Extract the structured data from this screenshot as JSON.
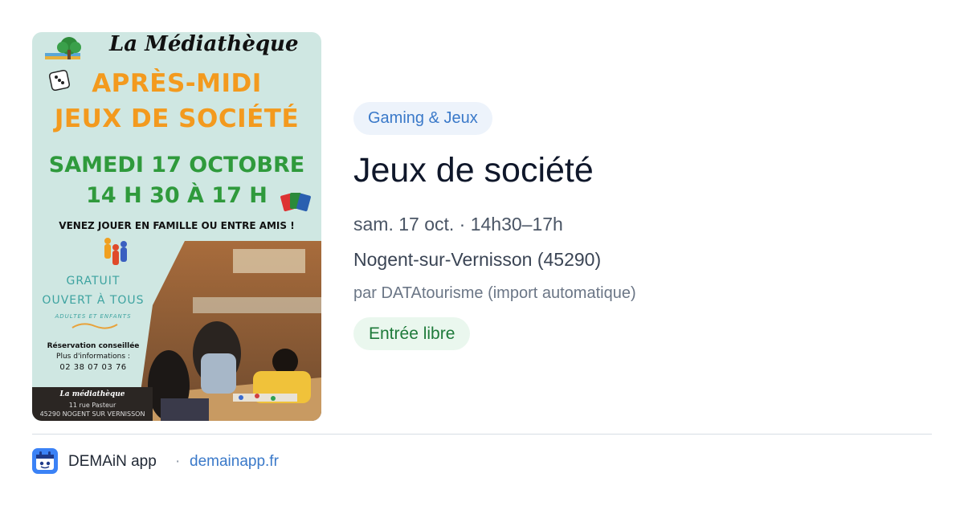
{
  "poster": {
    "title": "La Médiathèque",
    "headline_1": "APRÈS-MIDI",
    "headline_2": "JEUX DE SOCIÉTÉ",
    "date": "SAMEDI 17 OCTOBRE",
    "time": "14 H 30 À 17 H",
    "tagline": "VENEZ JOUER EN FAMILLE OU ENTRE AMIS !",
    "gratuit": "GRATUIT",
    "ouvert": "OUVERT À TOUS",
    "adultes": "ADULTES ET ENFANTS",
    "reservation": "Réservation conseillée",
    "info": "Plus d'informations :",
    "phone": "02 38 07 03 76",
    "footer_name": "La médiathèque",
    "footer_addr_1": "11 rue Pasteur",
    "footer_addr_2": "45290 NOGENT SUR VERNISSON",
    "colors": {
      "background": "#cfe7e2",
      "orange": "#f39a1e",
      "green": "#2f9a3c",
      "teal": "#3da3a0"
    }
  },
  "event": {
    "category": "Gaming & Jeux",
    "title": "Jeux de société",
    "datetime": "sam. 17 oct. · 14h30–17h",
    "location": "Nogent-sur-Vernisson (45290)",
    "author": "par DATAtourisme (import automatique)",
    "price": "Entrée libre"
  },
  "footer": {
    "app_icon": "demain-app-icon",
    "app_name": "DEMAiN app",
    "separator": "·",
    "domain": "demainapp.fr"
  },
  "colors": {
    "accent_blue": "#3a79c9",
    "category_bg": "#edf3fb",
    "price_bg": "#eaf7ee",
    "price_text": "#1e7a3a",
    "title_text": "#0f172a"
  }
}
